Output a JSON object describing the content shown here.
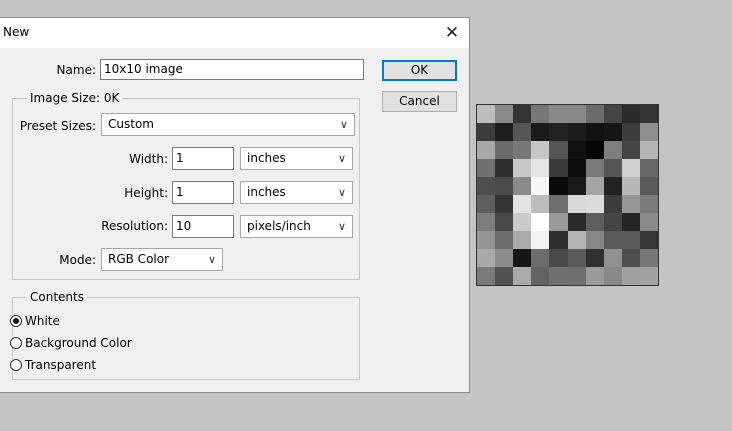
{
  "dialog": {
    "title": "New",
    "close_label": "✕",
    "name_label": "Name:",
    "name_value": "10x10 image",
    "ok_label": "OK",
    "cancel_label": "Cancel",
    "image_size_label": "Image Size: 0K",
    "preset_label": "Preset Sizes:",
    "preset_value": "Custom",
    "width_label": "Width:",
    "width_value": "1",
    "width_unit": "inches",
    "height_label": "Height:",
    "height_value": "1",
    "height_unit": "inches",
    "resolution_label": "Resolution:",
    "resolution_value": "10",
    "resolution_unit": "pixels/inch",
    "mode_label": "Mode:",
    "mode_value": "RGB Color",
    "contents_label": "Contents",
    "contents_options": [
      "White",
      "Background Color",
      "Transparent"
    ],
    "contents_selected": "White"
  },
  "colors": {
    "accent": "#0078d7",
    "dialog_bg": "#f0f0f0",
    "desktop_bg": "#c4c4c4"
  },
  "preview_pixels": [
    [
      "#bdbdbd",
      "#8a8a8a",
      "#333333",
      "#777777",
      "#888888",
      "#888888",
      "#6b6b6b",
      "#444444",
      "#2a2a2a",
      "#333333"
    ],
    [
      "#3c3c3c",
      "#1e1e1e",
      "#555555",
      "#1a1a1a",
      "#222222",
      "#1c1c1c",
      "#111111",
      "#161616",
      "#3d3d3d",
      "#8f8f8f"
    ],
    [
      "#a8a8a8",
      "#6a6a6a",
      "#777777",
      "#c6c6c6",
      "#555555",
      "#111111",
      "#050505",
      "#7e7e7e",
      "#444444",
      "#b5b5b5"
    ],
    [
      "#707070",
      "#2e2e2e",
      "#c8c8c8",
      "#e4e4e4",
      "#3a3a3a",
      "#0c0c0c",
      "#787878",
      "#555555",
      "#cfcfcf",
      "#666666"
    ],
    [
      "#4e4e4e",
      "#4a4a4a",
      "#8a8a8a",
      "#f7f7f7",
      "#0a0a0a",
      "#1a1a1a",
      "#a4a4a4",
      "#222222",
      "#b8b8b8",
      "#5a5a5a"
    ],
    [
      "#5e5e5e",
      "#343434",
      "#e3e3e3",
      "#bdbdbd",
      "#6e6e6e",
      "#d9d9d9",
      "#dcdcdc",
      "#3c3c3c",
      "#969696",
      "#7a7a7a"
    ],
    [
      "#7d7d7d",
      "#484848",
      "#cbcbcb",
      "#ffffff",
      "#999999",
      "#2a2a2a",
      "#5e5e5e",
      "#444444",
      "#252525",
      "#8a8a8a"
    ],
    [
      "#959595",
      "#6c6c6c",
      "#aaaaaa",
      "#f2f2f2",
      "#2e2e2e",
      "#b5b5b5",
      "#878787",
      "#5a5a5a",
      "#5a5a5a",
      "#363636"
    ],
    [
      "#a9a9a9",
      "#8c8c8c",
      "#161616",
      "#6c6c6c",
      "#494949",
      "#5b5b5b",
      "#303030",
      "#909090",
      "#4e4e4e",
      "#777777"
    ],
    [
      "#7a7a7a",
      "#515151",
      "#aaaaaa",
      "#636363",
      "#707070",
      "#6e6e6e",
      "#9a9a9a",
      "#888888",
      "#9f9f9f",
      "#a3a3a3"
    ]
  ]
}
